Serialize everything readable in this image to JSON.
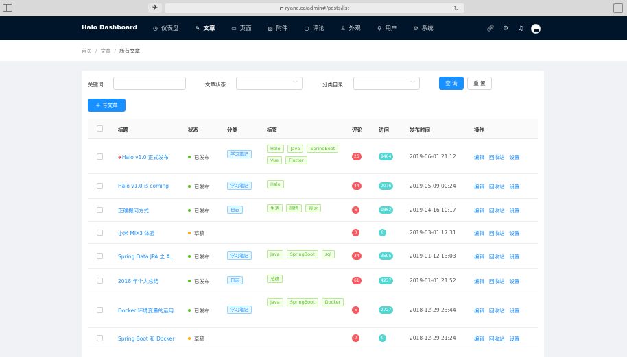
{
  "browser": {
    "url": "ryanc.cc/admin#/posts/list"
  },
  "nav": {
    "logo": "Halo  Dashboard",
    "items": [
      {
        "label": "仪表盘",
        "icon": "dashboard-icon",
        "glyph": "◷"
      },
      {
        "label": "文章",
        "icon": "edit-icon",
        "glyph": "✎"
      },
      {
        "label": "页面",
        "icon": "page-icon",
        "glyph": "▭"
      },
      {
        "label": "附件",
        "icon": "picture-icon",
        "glyph": "▨"
      },
      {
        "label": "评论",
        "icon": "comment-icon",
        "glyph": "○"
      },
      {
        "label": "外观",
        "icon": "skin-icon",
        "glyph": "♙"
      },
      {
        "label": "用户",
        "icon": "user-icon",
        "glyph": "♀"
      },
      {
        "label": "系统",
        "icon": "setting-icon",
        "glyph": "⚙"
      }
    ]
  },
  "breadcrumb": [
    "首页",
    "文章",
    "所有文章"
  ],
  "filters": {
    "keyword_label": "关键词:",
    "keyword_value": "",
    "status_label": "文章状态:",
    "status_value": "",
    "category_label": "分类目录:",
    "category_value": "",
    "query_button": "查 询",
    "reset_button": "重 置"
  },
  "write_button": "写文章",
  "table": {
    "headers": [
      "标题",
      "状态",
      "分类",
      "标签",
      "评论",
      "访问",
      "发布时间",
      "操作"
    ],
    "actions": [
      "编辑",
      "回收站",
      "设置"
    ],
    "rows": [
      {
        "title": "Halo v1.0 正式发布",
        "pinned": true,
        "status": "已发布",
        "published": true,
        "category": "学习笔记",
        "tags": [
          "Halo",
          "Java",
          "SpringBoot",
          "Vue",
          "Flutter"
        ],
        "comments": "26",
        "visits": "9464",
        "time": "2019-06-01 21:12"
      },
      {
        "title": "Halo v1.0 is coming",
        "pinned": false,
        "status": "已发布",
        "published": true,
        "category": "学习笔记",
        "tags": [
          "Halo"
        ],
        "comments": "44",
        "visits": "2076",
        "time": "2019-05-09 00:24"
      },
      {
        "title": "正确提问方式",
        "pinned": false,
        "status": "已发布",
        "published": true,
        "category": "日志",
        "tags": [
          "生活",
          "感悟",
          "表达"
        ],
        "comments": "6",
        "visits": "1862",
        "time": "2019-04-16 10:17"
      },
      {
        "title": "小米 MIX3 体验",
        "pinned": false,
        "status": "草稿",
        "published": false,
        "category": "",
        "tags": [],
        "comments": "0",
        "visits": "0",
        "time": "2019-03-01 17:31"
      },
      {
        "title": "Spring Data JPA 之 A...",
        "pinned": false,
        "status": "已发布",
        "published": true,
        "category": "学习笔记",
        "tags": [
          "Java",
          "SpringBoot",
          "sql"
        ],
        "comments": "34",
        "visits": "3595",
        "time": "2019-01-12 13:03"
      },
      {
        "title": "2018 年个人总结",
        "pinned": false,
        "status": "已发布",
        "published": true,
        "category": "日志",
        "tags": [
          "总结"
        ],
        "comments": "61",
        "visits": "4237",
        "time": "2019-01-01 21:52"
      },
      {
        "title": "Docker 环境变量的运用",
        "pinned": false,
        "status": "已发布",
        "published": true,
        "category": "学习笔记",
        "tags": [
          "Java",
          "SpringBoot",
          "Docker"
        ],
        "comments": "5",
        "visits": "2727",
        "time": "2018-12-29 23:44"
      },
      {
        "title": "Spring Boot 和 Docker",
        "pinned": false,
        "status": "草稿",
        "published": false,
        "category": "",
        "tags": [],
        "comments": "0",
        "visits": "0",
        "time": "2018-12-29 21:24"
      }
    ]
  },
  "colors": {
    "nav_bg": "#001529",
    "primary": "#1890ff",
    "published": "#52c41a",
    "draft": "#faad14"
  }
}
